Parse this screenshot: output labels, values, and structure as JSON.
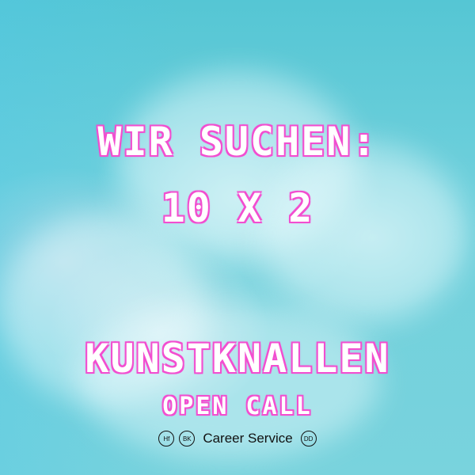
{
  "headline": {
    "line1": "WIR SUCHEN:",
    "line2": "10 X 2"
  },
  "event": {
    "title": "KUNSTKNALLEN",
    "subtitle": "OPEN CALL"
  },
  "footer": {
    "badge1": "Hf",
    "badge2": "BK",
    "label": "Career Service",
    "badge3": "DD"
  },
  "colors": {
    "sky": "#6fd0dc",
    "outline": "#f24fd0",
    "text": "#ffffff"
  }
}
